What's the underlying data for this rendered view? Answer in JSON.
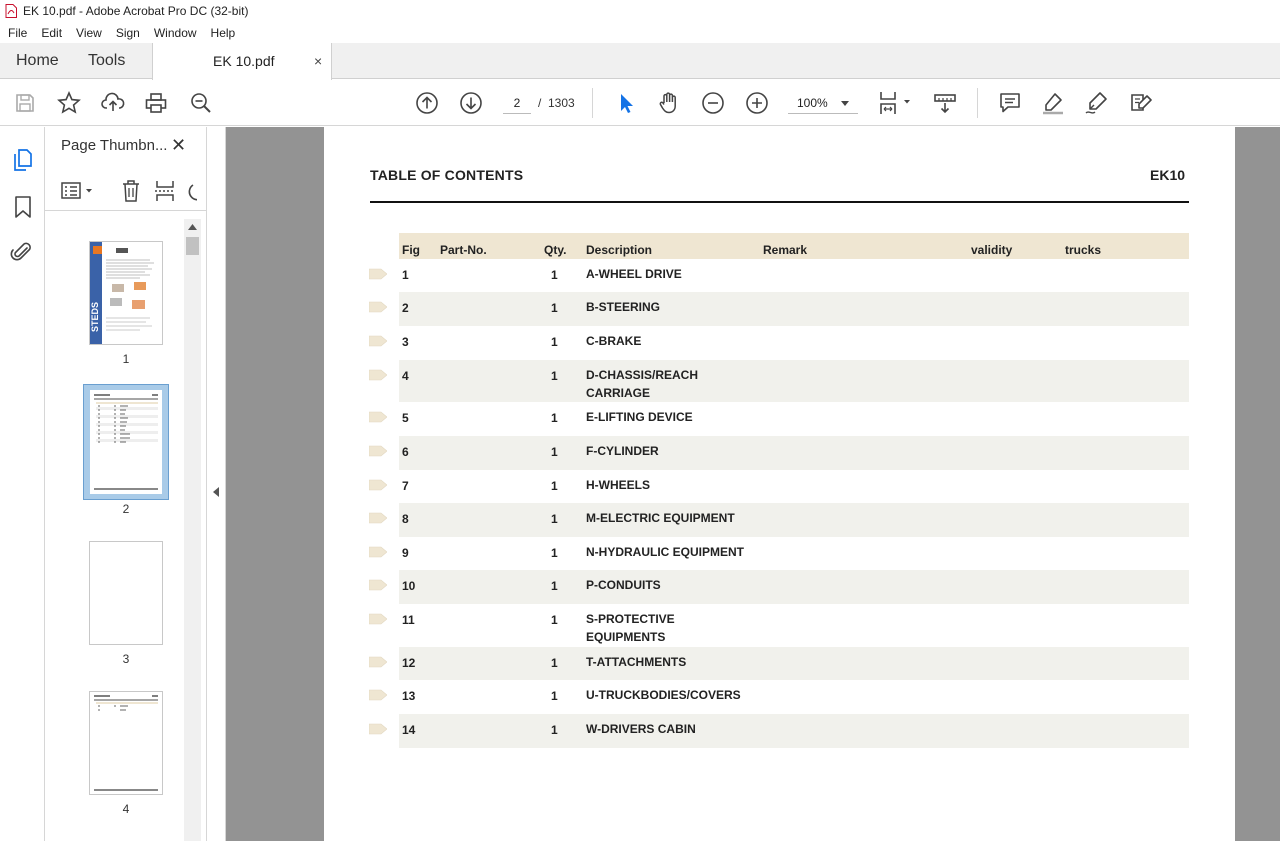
{
  "window": {
    "title": "EK 10.pdf - Adobe Acrobat Pro DC (32-bit)"
  },
  "menu": [
    "File",
    "Edit",
    "View",
    "Sign",
    "Window",
    "Help"
  ],
  "tabs": {
    "home": "Home",
    "tools": "Tools",
    "document": "EK 10.pdf",
    "close_glyph": "×"
  },
  "toolbar": {
    "current_page": "2",
    "page_separator": "/",
    "total_pages": "1303",
    "zoom": "100%",
    "icons": [
      "save-icon",
      "star-icon",
      "upload-icon",
      "print-icon",
      "search-zoom-icon",
      "page-up-icon",
      "page-down-icon",
      "select-cursor-icon",
      "hand-icon",
      "zoom-out-icon",
      "zoom-in-icon",
      "fit-page-icon",
      "scroll-mode-icon",
      "comment-icon",
      "highlight-icon",
      "sign-icon",
      "edit-pdf-icon"
    ]
  },
  "panel": {
    "title": "Page Thumbn...",
    "close_glyph": "✕",
    "thumbnails": [
      {
        "label": "1"
      },
      {
        "label": "2"
      },
      {
        "label": "3"
      },
      {
        "label": "4"
      }
    ]
  },
  "document": {
    "heading": "TABLE OF CONTENTS",
    "code": "EK10",
    "columns": {
      "fig": "Fig",
      "part_no": "Part-No.",
      "qty": "Qty.",
      "description": "Description",
      "remark": "Remark",
      "validity": "validity",
      "trucks": "trucks"
    },
    "rows": [
      {
        "fig": "1",
        "qty": "1",
        "description": "A-WHEEL DRIVE"
      },
      {
        "fig": "2",
        "qty": "1",
        "description": "B-STEERING"
      },
      {
        "fig": "3",
        "qty": "1",
        "description": "C-BRAKE"
      },
      {
        "fig": "4",
        "qty": "1",
        "description": "D-CHASSIS/REACH\nCARRIAGE"
      },
      {
        "fig": "5",
        "qty": "1",
        "description": "E-LIFTING DEVICE"
      },
      {
        "fig": "6",
        "qty": "1",
        "description": "F-CYLINDER"
      },
      {
        "fig": "7",
        "qty": "1",
        "description": "H-WHEELS"
      },
      {
        "fig": "8",
        "qty": "1",
        "description": "M-ELECTRIC EQUIPMENT"
      },
      {
        "fig": "9",
        "qty": "1",
        "description": "N-HYDRAULIC EQUIPMENT"
      },
      {
        "fig": "10",
        "qty": "1",
        "description": "P-CONDUITS"
      },
      {
        "fig": "11",
        "qty": "1",
        "description": "S-PROTECTIVE\nEQUIPMENTS"
      },
      {
        "fig": "12",
        "qty": "1",
        "description": "T-ATTACHMENTS"
      },
      {
        "fig": "13",
        "qty": "1",
        "description": "U-TRUCKBODIES/COVERS"
      },
      {
        "fig": "14",
        "qty": "1",
        "description": "W-DRIVERS CABIN"
      }
    ]
  },
  "colors": {
    "viewer_bg": "#939393",
    "header_bg": "#efe6d2",
    "row_alt": "#f1f1ec",
    "accent_blue": "#1473e6"
  }
}
